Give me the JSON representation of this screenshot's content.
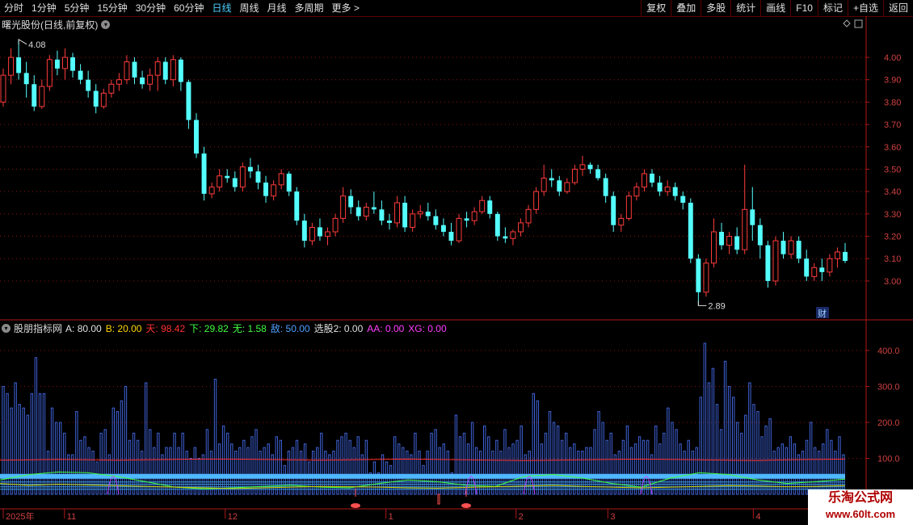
{
  "toolbar": {
    "periods": [
      "分时",
      "1分钟",
      "5分钟",
      "15分钟",
      "30分钟",
      "60分钟",
      "日线",
      "周线",
      "月线",
      "多周期",
      "更多 >"
    ],
    "active_period": "日线",
    "right_buttons": [
      "复权",
      "叠加",
      "多股",
      "统计",
      "画线",
      "F10",
      "标记",
      "+自选",
      "返回"
    ]
  },
  "main_panel": {
    "title": "曙光股份(日线,前复权)",
    "high_marker": "4.08",
    "low_marker": "2.89",
    "finance_badge": "财",
    "price_axis": [
      "4.00",
      "3.90",
      "3.80",
      "3.70",
      "3.60",
      "3.50",
      "3.40",
      "3.30",
      "3.20",
      "3.10",
      "3.00"
    ]
  },
  "indicator_panel": {
    "name": "股朋指标网",
    "values": [
      {
        "label": "A:",
        "value": "80.00",
        "color": "#e0e0e0"
      },
      {
        "label": "B:",
        "value": "20.00",
        "color": "#ffd700"
      },
      {
        "label": "天:",
        "value": "98.42",
        "color": "#ff3030"
      },
      {
        "label": "下:",
        "value": "29.82",
        "color": "#40ff40"
      },
      {
        "label": "无:",
        "value": "1.58",
        "color": "#40ff40"
      },
      {
        "label": "敌:",
        "value": "50.00",
        "color": "#4fa0ff"
      },
      {
        "label": "选股2:",
        "value": "0.00",
        "color": "#e0e0e0"
      },
      {
        "label": "AA:",
        "value": "0.00",
        "color": "#ff40ff"
      },
      {
        "label": "XG:",
        "value": "0.00",
        "color": "#ff40ff"
      }
    ],
    "axis": [
      "400.0",
      "300.0",
      "200.0",
      "100.0"
    ]
  },
  "date_axis": [
    {
      "label": "2025年",
      "pos": 0
    },
    {
      "label": "11",
      "pos": 8
    },
    {
      "label": "12",
      "pos": 29
    },
    {
      "label": "1",
      "pos": 50
    },
    {
      "label": "2",
      "pos": 67
    },
    {
      "label": "3",
      "pos": 79
    },
    {
      "label": "4",
      "pos": 98
    }
  ],
  "watermark": {
    "line1": "乐淘公式网",
    "line2": "www.60lt.com"
  },
  "colors": {
    "up": "#ff3b3b",
    "down": "#54ffff",
    "axis": "#b01818",
    "grid": "#8a1515"
  },
  "chart_data": {
    "type": "candlestick",
    "candles": [
      [
        3.8,
        3.95,
        3.78,
        3.92
      ],
      [
        3.92,
        4.04,
        3.88,
        4.0
      ],
      [
        4.0,
        4.08,
        3.9,
        3.93
      ],
      [
        3.93,
        3.98,
        3.82,
        3.88
      ],
      [
        3.88,
        3.92,
        3.76,
        3.78
      ],
      [
        3.78,
        3.9,
        3.77,
        3.87
      ],
      [
        3.87,
        4.01,
        3.85,
        3.99
      ],
      [
        3.99,
        4.03,
        3.92,
        3.95
      ],
      [
        3.95,
        4.04,
        3.9,
        4.0
      ],
      [
        4.0,
        4.02,
        3.91,
        3.94
      ],
      [
        3.94,
        3.97,
        3.88,
        3.9
      ],
      [
        3.9,
        3.94,
        3.82,
        3.85
      ],
      [
        3.85,
        3.88,
        3.75,
        3.78
      ],
      [
        3.78,
        3.86,
        3.77,
        3.84
      ],
      [
        3.84,
        3.9,
        3.82,
        3.88
      ],
      [
        3.88,
        3.93,
        3.85,
        3.9
      ],
      [
        3.9,
        4.01,
        3.88,
        3.98
      ],
      [
        3.98,
        4.0,
        3.88,
        3.91
      ],
      [
        3.91,
        3.94,
        3.86,
        3.88
      ],
      [
        3.88,
        3.95,
        3.85,
        3.92
      ],
      [
        3.92,
        4.0,
        3.85,
        3.98
      ],
      [
        3.98,
        4.0,
        3.88,
        3.9
      ],
      [
        3.9,
        4.01,
        3.87,
        3.99
      ],
      [
        3.99,
        4.0,
        3.85,
        3.89
      ],
      [
        3.89,
        3.9,
        3.68,
        3.72
      ],
      [
        3.72,
        3.75,
        3.55,
        3.57
      ],
      [
        3.57,
        3.6,
        3.36,
        3.39
      ],
      [
        3.39,
        3.44,
        3.37,
        3.42
      ],
      [
        3.42,
        3.5,
        3.4,
        3.47
      ],
      [
        3.47,
        3.5,
        3.44,
        3.46
      ],
      [
        3.46,
        3.49,
        3.4,
        3.42
      ],
      [
        3.42,
        3.53,
        3.4,
        3.51
      ],
      [
        3.51,
        3.55,
        3.46,
        3.49
      ],
      [
        3.49,
        3.52,
        3.41,
        3.44
      ],
      [
        3.44,
        3.47,
        3.35,
        3.38
      ],
      [
        3.38,
        3.45,
        3.36,
        3.43
      ],
      [
        3.43,
        3.5,
        3.41,
        3.48
      ],
      [
        3.48,
        3.49,
        3.38,
        3.4
      ],
      [
        3.4,
        3.42,
        3.25,
        3.27
      ],
      [
        3.27,
        3.3,
        3.15,
        3.18
      ],
      [
        3.18,
        3.26,
        3.16,
        3.24
      ],
      [
        3.24,
        3.28,
        3.18,
        3.2
      ],
      [
        3.2,
        3.24,
        3.16,
        3.22
      ],
      [
        3.22,
        3.3,
        3.2,
        3.28
      ],
      [
        3.28,
        3.42,
        3.26,
        3.38
      ],
      [
        3.38,
        3.41,
        3.3,
        3.33
      ],
      [
        3.33,
        3.36,
        3.27,
        3.29
      ],
      [
        3.29,
        3.35,
        3.27,
        3.33
      ],
      [
        3.33,
        3.4,
        3.3,
        3.32
      ],
      [
        3.32,
        3.36,
        3.25,
        3.27
      ],
      [
        3.27,
        3.3,
        3.23,
        3.26
      ],
      [
        3.26,
        3.38,
        3.24,
        3.35
      ],
      [
        3.35,
        3.38,
        3.22,
        3.24
      ],
      [
        3.24,
        3.32,
        3.22,
        3.3
      ],
      [
        3.3,
        3.34,
        3.28,
        3.31
      ],
      [
        3.31,
        3.35,
        3.27,
        3.29
      ],
      [
        3.29,
        3.32,
        3.23,
        3.25
      ],
      [
        3.25,
        3.28,
        3.2,
        3.22
      ],
      [
        3.22,
        3.26,
        3.16,
        3.18
      ],
      [
        3.18,
        3.3,
        3.17,
        3.28
      ],
      [
        3.28,
        3.31,
        3.24,
        3.27
      ],
      [
        3.27,
        3.33,
        3.25,
        3.31
      ],
      [
        3.31,
        3.38,
        3.3,
        3.36
      ],
      [
        3.36,
        3.38,
        3.28,
        3.3
      ],
      [
        3.3,
        3.31,
        3.18,
        3.2
      ],
      [
        3.2,
        3.24,
        3.17,
        3.19
      ],
      [
        3.19,
        3.23,
        3.16,
        3.22
      ],
      [
        3.22,
        3.28,
        3.2,
        3.26
      ],
      [
        3.26,
        3.34,
        3.24,
        3.32
      ],
      [
        3.32,
        3.42,
        3.3,
        3.4
      ],
      [
        3.4,
        3.52,
        3.38,
        3.46
      ],
      [
        3.46,
        3.5,
        3.42,
        3.45
      ],
      [
        3.45,
        3.47,
        3.38,
        3.4
      ],
      [
        3.4,
        3.46,
        3.39,
        3.44
      ],
      [
        3.44,
        3.52,
        3.43,
        3.5
      ],
      [
        3.5,
        3.56,
        3.47,
        3.52
      ],
      [
        3.52,
        3.53,
        3.48,
        3.5
      ],
      [
        3.5,
        3.52,
        3.45,
        3.46
      ],
      [
        3.46,
        3.48,
        3.35,
        3.38
      ],
      [
        3.38,
        3.4,
        3.22,
        3.25
      ],
      [
        3.25,
        3.3,
        3.22,
        3.28
      ],
      [
        3.28,
        3.4,
        3.27,
        3.38
      ],
      [
        3.38,
        3.44,
        3.36,
        3.42
      ],
      [
        3.42,
        3.5,
        3.4,
        3.48
      ],
      [
        3.48,
        3.5,
        3.42,
        3.44
      ],
      [
        3.44,
        3.47,
        3.38,
        3.4
      ],
      [
        3.4,
        3.45,
        3.38,
        3.42
      ],
      [
        3.42,
        3.44,
        3.36,
        3.38
      ],
      [
        3.38,
        3.4,
        3.32,
        3.35
      ],
      [
        3.35,
        3.37,
        3.08,
        3.1
      ],
      [
        3.1,
        3.12,
        2.89,
        2.95
      ],
      [
        2.95,
        3.1,
        2.93,
        3.08
      ],
      [
        3.08,
        3.28,
        3.06,
        3.22
      ],
      [
        3.22,
        3.26,
        3.14,
        3.16
      ],
      [
        3.16,
        3.22,
        3.12,
        3.2
      ],
      [
        3.2,
        3.24,
        3.12,
        3.14
      ],
      [
        3.14,
        3.52,
        3.12,
        3.32
      ],
      [
        3.32,
        3.42,
        3.18,
        3.25
      ],
      [
        3.25,
        3.28,
        3.1,
        3.16
      ],
      [
        3.16,
        3.18,
        2.97,
        3.0
      ],
      [
        3.0,
        3.2,
        2.98,
        3.18
      ],
      [
        3.18,
        3.22,
        3.1,
        3.12
      ],
      [
        3.12,
        3.2,
        3.1,
        3.18
      ],
      [
        3.18,
        3.2,
        3.08,
        3.1
      ],
      [
        3.1,
        3.14,
        3.0,
        3.02
      ],
      [
        3.02,
        3.08,
        3.0,
        3.06
      ],
      [
        3.06,
        3.1,
        3.0,
        3.04
      ],
      [
        3.04,
        3.12,
        3.02,
        3.1
      ],
      [
        3.1,
        3.15,
        3.06,
        3.13
      ],
      [
        3.13,
        3.17,
        3.08,
        3.09
      ]
    ],
    "indicator_bars": [
      300,
      280,
      240,
      310,
      250,
      240,
      220,
      280,
      380,
      280,
      280,
      120,
      240,
      200,
      200,
      170,
      110,
      110,
      230,
      150,
      160,
      130,
      120,
      90,
      170,
      180,
      110,
      240,
      230,
      260,
      300,
      150,
      170,
      150,
      120,
      310,
      180,
      130,
      170,
      110,
      130,
      130,
      170,
      130,
      170,
      120,
      100,
      130,
      100,
      110,
      180,
      120,
      320,
      140,
      190,
      170,
      140,
      120,
      130,
      150,
      130,
      160,
      180,
      120,
      130,
      140,
      110,
      160,
      150,
      80,
      120,
      130,
      150,
      120,
      140,
      90,
      120,
      130,
      170,
      120,
      110,
      120,
      150,
      160,
      170,
      150,
      130,
      160,
      110,
      150,
      60,
      90,
      60,
      110,
      90,
      80,
      160,
      140,
      130,
      120,
      110,
      170,
      120,
      80,
      120,
      170,
      180,
      130,
      140,
      120,
      60,
      220,
      160,
      170,
      140,
      200,
      130,
      120,
      190,
      160,
      120,
      150,
      120,
      180,
      130,
      140,
      150,
      190,
      110,
      120,
      280,
      260,
      140,
      170,
      230,
      200,
      190,
      150,
      170,
      130,
      140,
      120,
      120,
      130,
      130,
      180,
      230,
      200,
      150,
      170,
      110,
      120,
      150,
      190,
      130,
      140,
      160,
      150,
      150,
      110,
      190,
      140,
      170,
      240,
      200,
      180,
      140,
      120,
      150,
      120,
      130,
      270,
      420,
      310,
      350,
      250,
      180,
      370,
      300,
      270,
      200,
      170,
      220,
      310,
      250,
      230,
      160,
      190,
      210,
      120,
      130,
      140,
      130,
      160,
      140,
      110,
      120,
      150,
      200,
      130,
      120,
      140,
      180,
      150,
      120,
      160,
      110
    ],
    "line_red": [
      95,
      96,
      97,
      96,
      95,
      96,
      97,
      98,
      98,
      97,
      96,
      95,
      96,
      97,
      98,
      97,
      96,
      95,
      94,
      95,
      96,
      97,
      98,
      97,
      96,
      95,
      94,
      96,
      97,
      98
    ],
    "line_green": [
      40,
      55,
      62,
      60,
      50,
      35,
      20,
      15,
      18,
      22,
      25,
      20,
      18,
      30,
      40,
      35,
      25,
      22,
      50,
      55,
      45,
      30,
      20,
      45,
      60,
      55,
      40,
      30,
      35,
      42
    ],
    "line_yellow": [
      30,
      25,
      28,
      26,
      24,
      22,
      20,
      18,
      16,
      18,
      20,
      22,
      21,
      20,
      18,
      17,
      19,
      21,
      23,
      25,
      22,
      20,
      18,
      20,
      22,
      24,
      23,
      21,
      22,
      24
    ],
    "band_cyan": 50,
    "ylim_price": [
      2.83,
      4.13
    ],
    "ylim_indicator": [
      0,
      420
    ],
    "ylabel": "",
    "xlabel": ""
  }
}
